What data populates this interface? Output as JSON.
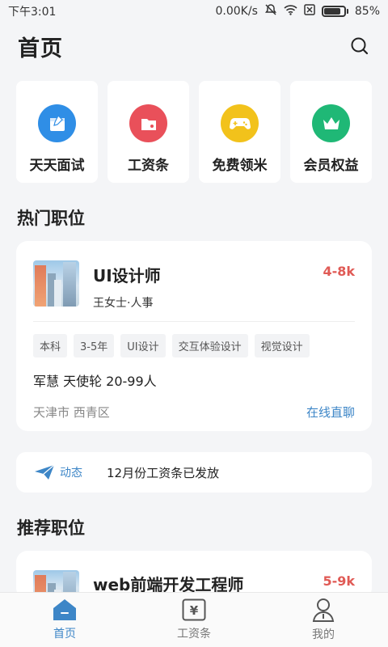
{
  "status_bar": {
    "time": "下午3:01",
    "net_speed": "0.00K/s",
    "battery": "85%"
  },
  "header": {
    "title": "首页"
  },
  "quick_entries": [
    {
      "label": "天天面试",
      "icon": "calendar-icon",
      "color": "#2f8ee6"
    },
    {
      "label": "工资条",
      "icon": "folder-icon",
      "color": "#e9505a"
    },
    {
      "label": "免费领米",
      "icon": "gamepad-icon",
      "color": "#f2c21b"
    },
    {
      "label": "会员权益",
      "icon": "crown-icon",
      "color": "#1fb876"
    }
  ],
  "hot_section": {
    "title": "热门职位",
    "job": {
      "title": "UI设计师",
      "poster": "王女士·人事",
      "salary": "4-8k",
      "tags": [
        "本科",
        "3-5年",
        "UI设计",
        "交互体验设计",
        "视觉设计"
      ],
      "company": "军慧 天使轮 20-99人",
      "location": "天津市 西青区",
      "chat_label": "在线直聊"
    }
  },
  "news": {
    "tag": "动态",
    "text": "12月份工资条已发放"
  },
  "rec_section": {
    "title": "推荐职位",
    "job": {
      "title": "web前端开发工程师",
      "salary": "5-9k"
    }
  },
  "tabbar": {
    "tabs": [
      {
        "label": "首页",
        "icon": "home-icon",
        "active": true
      },
      {
        "label": "工资条",
        "icon": "yen-icon",
        "active": false
      },
      {
        "label": "我的",
        "icon": "person-icon",
        "active": false
      }
    ]
  },
  "colors": {
    "accent": "#3d86c7",
    "salary": "#e05a55",
    "background": "#f4f5f7"
  }
}
